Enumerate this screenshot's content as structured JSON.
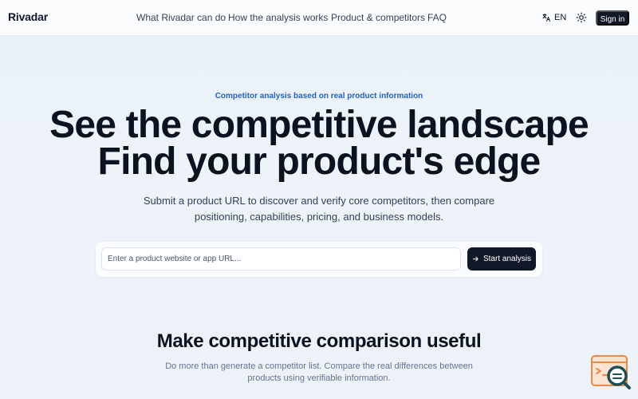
{
  "nav": {
    "brand": "Rivadar",
    "links": [
      "What Rivadar can do",
      "How the analysis works",
      "Product & competitors",
      "FAQ"
    ],
    "language": "EN",
    "theme_icon": "sun-icon",
    "language_icon": "translate-icon",
    "signin_label": "Sign in"
  },
  "hero": {
    "eyebrow": "Competitor analysis based on real product information",
    "headline_line1": "See the competitive landscape",
    "headline_line2": "Find your product's edge",
    "subtitle": "Submit a product URL to discover and verify core competitors, then compare positioning, capabilities, pricing, and business models.",
    "search": {
      "placeholder": "Enter a product website or app URL...",
      "value": "",
      "button_label": "Start analysis",
      "button_icon": "arrow-right-icon"
    }
  },
  "section": {
    "title": "Make competitive comparison useful",
    "description": "Do more than generate a competitor list. Compare the real differences between products using verifiable information."
  },
  "floating_widget": {
    "icon": "window-search-icon"
  },
  "colors": {
    "accent": "#2563b6",
    "dark": "#111827",
    "widget_orange": "#e98a4b",
    "widget_teal": "#1f4f52"
  }
}
